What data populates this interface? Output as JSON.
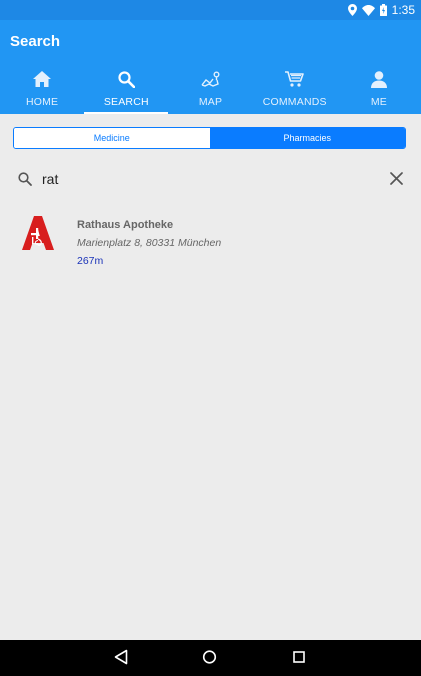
{
  "status_bar": {
    "time": "1:35",
    "icons": [
      "location-icon",
      "wifi-icon",
      "battery-charging-icon"
    ]
  },
  "app_bar": {
    "title": "Search",
    "tabs": [
      {
        "label": "HOME",
        "icon": "home-icon",
        "active": false
      },
      {
        "label": "SEARCH",
        "icon": "search-icon",
        "active": true
      },
      {
        "label": "MAP",
        "icon": "map-icon",
        "active": false
      },
      {
        "label": "COMMANDS",
        "icon": "cart-icon",
        "active": false
      },
      {
        "label": "ME",
        "icon": "person-icon",
        "active": false
      }
    ]
  },
  "segmented": {
    "options": [
      "Medicine",
      "Pharmacies"
    ],
    "selected": "Pharmacies"
  },
  "search": {
    "value": "rat",
    "icon": "search-icon",
    "clear_icon": "close-icon"
  },
  "results": [
    {
      "name": "Rathaus Apotheke",
      "address": "Marienplatz 8, 80331 München",
      "distance": "267m",
      "logo": "apotheke-logo"
    }
  ],
  "nav_bar": {
    "buttons": [
      "back-icon",
      "home-circle-icon",
      "recents-icon"
    ]
  },
  "colors": {
    "app_bar": "#2196f3",
    "status_bar": "#1e88e5",
    "accent": "#0a7cff",
    "logo_red": "#d81e1e",
    "distance": "#1a33b8"
  }
}
